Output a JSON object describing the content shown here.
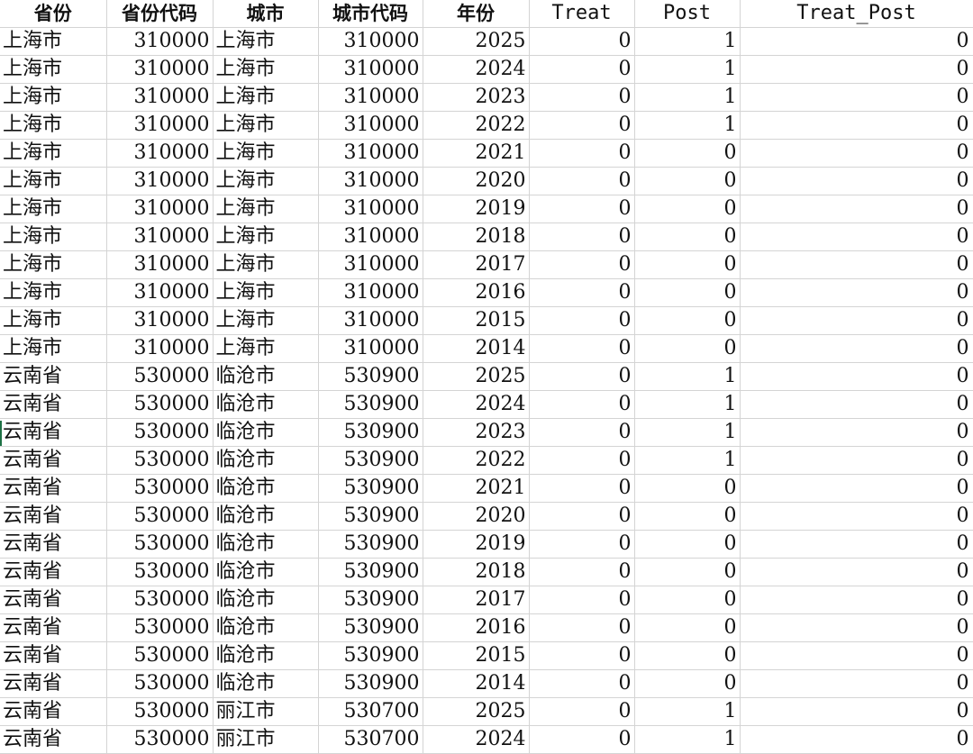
{
  "table": {
    "headers": [
      "省份",
      "省份代码",
      "城市",
      "城市代码",
      "年份",
      "Treat",
      "Post",
      "Treat_Post"
    ],
    "rows": [
      [
        "上海市",
        "310000",
        "上海市",
        "310000",
        "2025",
        "0",
        "1",
        "0"
      ],
      [
        "上海市",
        "310000",
        "上海市",
        "310000",
        "2024",
        "0",
        "1",
        "0"
      ],
      [
        "上海市",
        "310000",
        "上海市",
        "310000",
        "2023",
        "0",
        "1",
        "0"
      ],
      [
        "上海市",
        "310000",
        "上海市",
        "310000",
        "2022",
        "0",
        "1",
        "0"
      ],
      [
        "上海市",
        "310000",
        "上海市",
        "310000",
        "2021",
        "0",
        "0",
        "0"
      ],
      [
        "上海市",
        "310000",
        "上海市",
        "310000",
        "2020",
        "0",
        "0",
        "0"
      ],
      [
        "上海市",
        "310000",
        "上海市",
        "310000",
        "2019",
        "0",
        "0",
        "0"
      ],
      [
        "上海市",
        "310000",
        "上海市",
        "310000",
        "2018",
        "0",
        "0",
        "0"
      ],
      [
        "上海市",
        "310000",
        "上海市",
        "310000",
        "2017",
        "0",
        "0",
        "0"
      ],
      [
        "上海市",
        "310000",
        "上海市",
        "310000",
        "2016",
        "0",
        "0",
        "0"
      ],
      [
        "上海市",
        "310000",
        "上海市",
        "310000",
        "2015",
        "0",
        "0",
        "0"
      ],
      [
        "上海市",
        "310000",
        "上海市",
        "310000",
        "2014",
        "0",
        "0",
        "0"
      ],
      [
        "云南省",
        "530000",
        "临沧市",
        "530900",
        "2025",
        "0",
        "1",
        "0"
      ],
      [
        "云南省",
        "530000",
        "临沧市",
        "530900",
        "2024",
        "0",
        "1",
        "0"
      ],
      [
        "云南省",
        "530000",
        "临沧市",
        "530900",
        "2023",
        "0",
        "1",
        "0"
      ],
      [
        "云南省",
        "530000",
        "临沧市",
        "530900",
        "2022",
        "0",
        "1",
        "0"
      ],
      [
        "云南省",
        "530000",
        "临沧市",
        "530900",
        "2021",
        "0",
        "0",
        "0"
      ],
      [
        "云南省",
        "530000",
        "临沧市",
        "530900",
        "2020",
        "0",
        "0",
        "0"
      ],
      [
        "云南省",
        "530000",
        "临沧市",
        "530900",
        "2019",
        "0",
        "0",
        "0"
      ],
      [
        "云南省",
        "530000",
        "临沧市",
        "530900",
        "2018",
        "0",
        "0",
        "0"
      ],
      [
        "云南省",
        "530000",
        "临沧市",
        "530900",
        "2017",
        "0",
        "0",
        "0"
      ],
      [
        "云南省",
        "530000",
        "临沧市",
        "530900",
        "2016",
        "0",
        "0",
        "0"
      ],
      [
        "云南省",
        "530000",
        "临沧市",
        "530900",
        "2015",
        "0",
        "0",
        "0"
      ],
      [
        "云南省",
        "530000",
        "临沧市",
        "530900",
        "2014",
        "0",
        "0",
        "0"
      ],
      [
        "云南省",
        "530000",
        "丽江市",
        "530700",
        "2025",
        "0",
        "1",
        "0"
      ],
      [
        "云南省",
        "530000",
        "丽江市",
        "530700",
        "2024",
        "0",
        "1",
        "0"
      ]
    ]
  },
  "colors": {
    "gridline": "#d4d4d4",
    "text": "#111111",
    "active_row_marker": "#1e7145"
  }
}
